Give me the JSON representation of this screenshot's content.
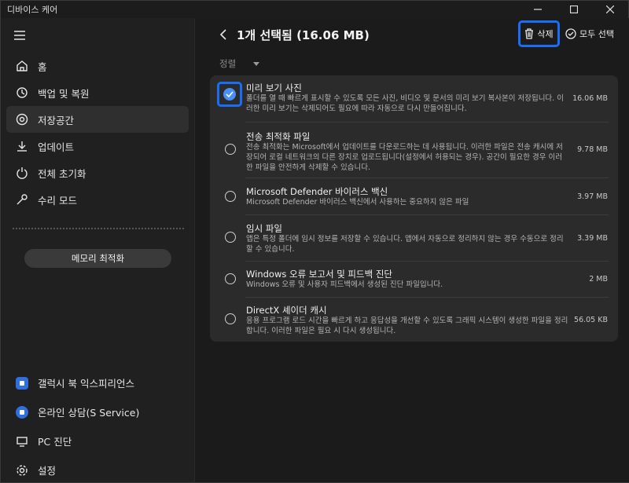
{
  "window": {
    "title": "디바이스 케어"
  },
  "sidebar": {
    "items": [
      {
        "label": "홈",
        "icon": "home-icon"
      },
      {
        "label": "백업 및 복원",
        "icon": "history-icon"
      },
      {
        "label": "저장공간",
        "icon": "storage-icon",
        "active": true
      },
      {
        "label": "업데이트",
        "icon": "download-icon"
      },
      {
        "label": "전체 초기화",
        "icon": "reset-icon"
      },
      {
        "label": "수리 모드",
        "icon": "wrench-icon"
      }
    ],
    "memory_button": "메모리 최적화",
    "bottom_items": [
      {
        "label": "갤럭시 북 익스피리언스",
        "icon": "galaxy-experience-icon"
      },
      {
        "label": "온라인 상담(S Service)",
        "icon": "service-icon"
      },
      {
        "label": "PC 진단",
        "icon": "diagnosis-icon"
      },
      {
        "label": "설정",
        "icon": "settings-icon"
      }
    ]
  },
  "header": {
    "title": "1개 선택됨 (16.06 MB)",
    "delete_label": "삭제",
    "select_all_label": "모두 선택",
    "sort_label": "정렬"
  },
  "files": [
    {
      "name": "미리 보기 사진",
      "desc": "폴더를 열 때 빠르게 표시할 수 있도록 모든 사진, 비디오 및 문서의 미리 보기 복사본이 저장됩니다. 이러한 미리 보기는 삭제되어도 필요에 따라 자동으로 다시 만들어집니다.",
      "size": "16.06 MB",
      "selected": true
    },
    {
      "name": "전송 최적화 파일",
      "desc": "전송 최적화는 Microsoft에서 업데이트를 다운로드하는 데 사용됩니다. 이러한 파일은 전송 캐시에 저장되어 로컬 네트워크의 다른 장치로 업로드됩니다(설정에서 허용되는 경우). 공간이 필요한 경우 이러한 파일을 안전하게 삭제할 수 있습니다.",
      "size": "9.78 MB",
      "selected": false
    },
    {
      "name": "Microsoft Defender 바이러스 백신",
      "desc": "Microsoft Defender 바이러스 백신에서 사용하는 중요하지 않은 파일",
      "size": "3.97 MB",
      "selected": false
    },
    {
      "name": "임시 파일",
      "desc": "앱은 특정 폴더에 임시 정보를 저장할 수 있습니다. 앱에서 자동으로 정리하지 않는 경우 수동으로 정리할 수 있습니다.",
      "size": "3.39 MB",
      "selected": false
    },
    {
      "name": "Windows 오류 보고서 및 피드백 진단",
      "desc": "Windows 오류 및 사용자 피드백에서 생성된 진단 파일입니다.",
      "size": "2 MB",
      "selected": false
    },
    {
      "name": "DirectX 셰이더 캐시",
      "desc": "응용 프로그램 로드 시간을 빠르게 하고 응답성을 개선할 수 있도록 그래픽 시스템이 생성한 파일을 정리합니다. 이러한 파일은 필요 시 다시 생성됩니다.",
      "size": "56.05 KB",
      "selected": false
    }
  ],
  "colors": {
    "accent": "#1a6ef5",
    "check": "#4a8ef8"
  }
}
